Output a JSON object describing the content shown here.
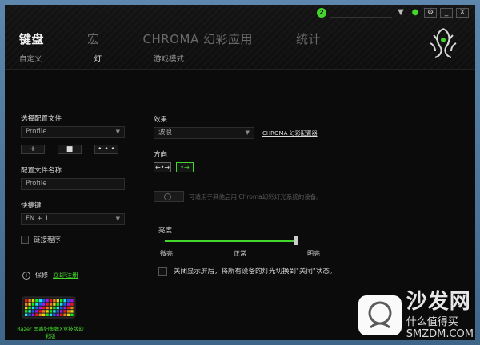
{
  "title_bar": {
    "notification_count": "2",
    "minimize": "_",
    "close": "X",
    "settings_icon": "gear-icon"
  },
  "main_tabs": [
    {
      "label": "键盘",
      "active": true
    },
    {
      "label": "宏",
      "active": false
    },
    {
      "label": "CHROMA 幻彩应用",
      "active": false
    },
    {
      "label": "统计",
      "active": false
    }
  ],
  "sub_tabs": [
    {
      "label": "自定义",
      "active": false
    },
    {
      "label": "灯",
      "active": true
    },
    {
      "label": "游戏模式",
      "active": false
    }
  ],
  "left_panel": {
    "profile_label": "选择配置文件",
    "profile_value": "Profile",
    "btn_add": "+",
    "btn_delete": "■",
    "btn_more": "• • •",
    "profile_name_label": "配置文件名称",
    "profile_name_value": "Profile",
    "shortcut_label": "快捷键",
    "shortcut_value": "FN + 1",
    "link_program_label": "链接程序"
  },
  "right_panel": {
    "effect_label": "效果",
    "effect_value": "波浪",
    "chroma_configurator_link": "CHROMA 幻彩配置器",
    "direction_label": "方向",
    "dir_left": "←•→",
    "dir_right": "•→",
    "sync_text": "可适用于其他启用 Chroma幻彩灯光系统的设备。",
    "brightness_label": "亮度",
    "brightness_value": 1.0,
    "brightness_marks": [
      "微亮",
      "正常",
      "明亮"
    ],
    "screen_off_text": "关闭显示屏后，将所有设备的灯光切换到\"关闭\"状态。"
  },
  "footer": {
    "save_label": "保修",
    "register_link": "立即注册",
    "device_name": "Razer 黑寡妇蜘蛛X竞技版幻彩版"
  },
  "watermark": {
    "title": "沙发网",
    "subtitle": "什么值得买",
    "site": "SMZDM.COM"
  },
  "colors": {
    "accent": "#44d62c",
    "background": "#0b0b0b"
  }
}
